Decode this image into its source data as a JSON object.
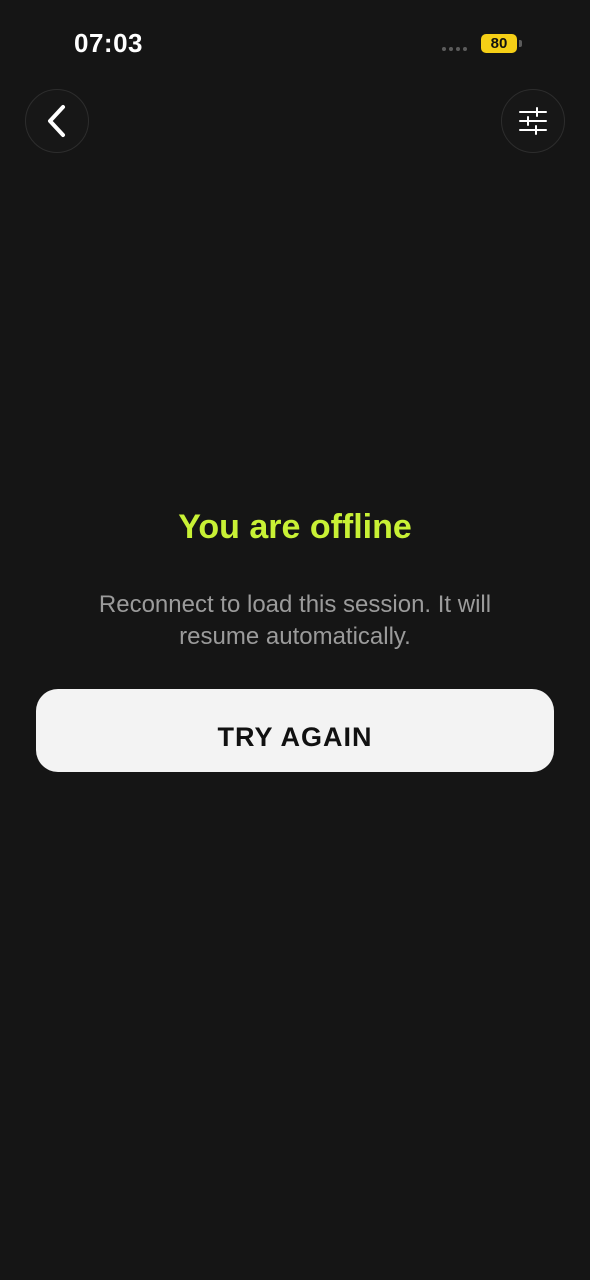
{
  "status_bar": {
    "time": "07:03",
    "battery": "80"
  },
  "header": {
    "back_icon": "chevron-left-icon",
    "filter_icon": "sliders-icon"
  },
  "message": {
    "title": "You are offline",
    "description": "Reconnect to load this session. It will resume automatically."
  },
  "actions": {
    "try_again_label": "TRY AGAIN"
  },
  "colors": {
    "background": "#151515",
    "accent": "#c8f135",
    "battery": "#f5cf16",
    "button": "#f3f3f3"
  }
}
